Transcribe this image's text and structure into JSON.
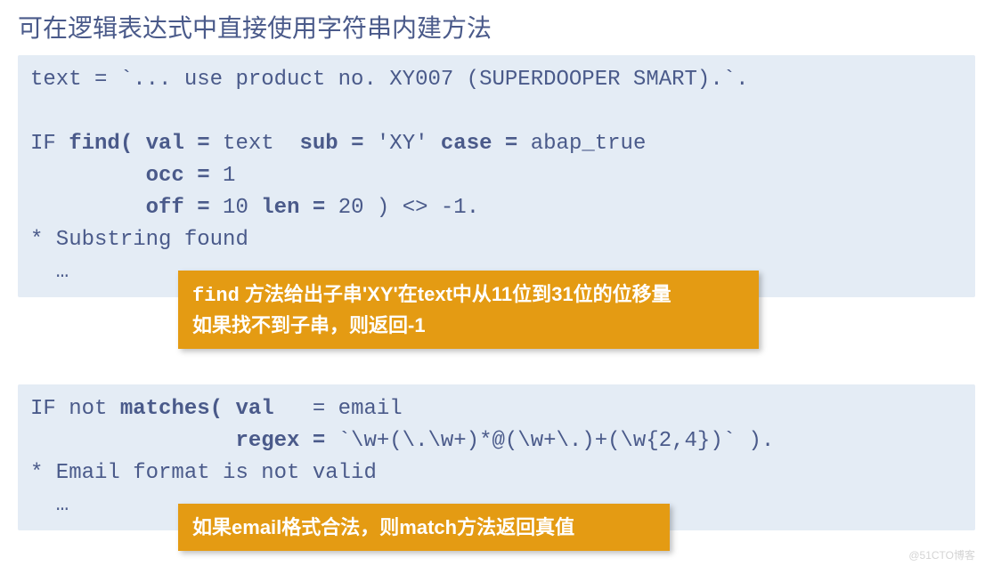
{
  "heading": "可在逻辑表达式中直接使用字符串内建方法",
  "code1": {
    "l1a": "text = `... use product no. XY007 (SUPERDOOPER SMART).`.",
    "l2a": "IF ",
    "l2b": "find( val = ",
    "l2c": "text  ",
    "l2d": "sub = ",
    "l2e": "'XY' ",
    "l2f": "case = ",
    "l2g": "abap_true",
    "l3a": "         ",
    "l3b": "occ = ",
    "l3c": "1",
    "l4a": "         ",
    "l4b": "off = ",
    "l4c": "10 ",
    "l4d": "len = ",
    "l4e": "20 ) <> -1.",
    "l5": "* Substring found",
    "l6": "  …"
  },
  "callout1": {
    "t1a": "find",
    "t1b": " 方法给出子串",
    "t1c": "'XY'",
    "t1d": "在",
    "t1e": "text",
    "t1f": "中从",
    "t1g": "11",
    "t1h": "位到",
    "t1i": "31",
    "t1j": "位的位移量",
    "t2a": "如果找不到子串，则返回",
    "t2b": "-1"
  },
  "code2": {
    "l1a": "IF not ",
    "l1b": "matches( val   ",
    "l1c": "= email",
    "l2a": "                ",
    "l2b": "regex = ",
    "l2c": "`\\w+(\\.\\w+)*@(\\w+\\.)+(\\w{2,4})` ).",
    "l3": "* Email format is not valid",
    "l4": "  …"
  },
  "callout2": {
    "t1a": "如果",
    "t1b": "email",
    "t1c": "格式合法，则",
    "t1d": "match",
    "t1e": "方法返回真值"
  },
  "watermark": "@51CTO博客"
}
